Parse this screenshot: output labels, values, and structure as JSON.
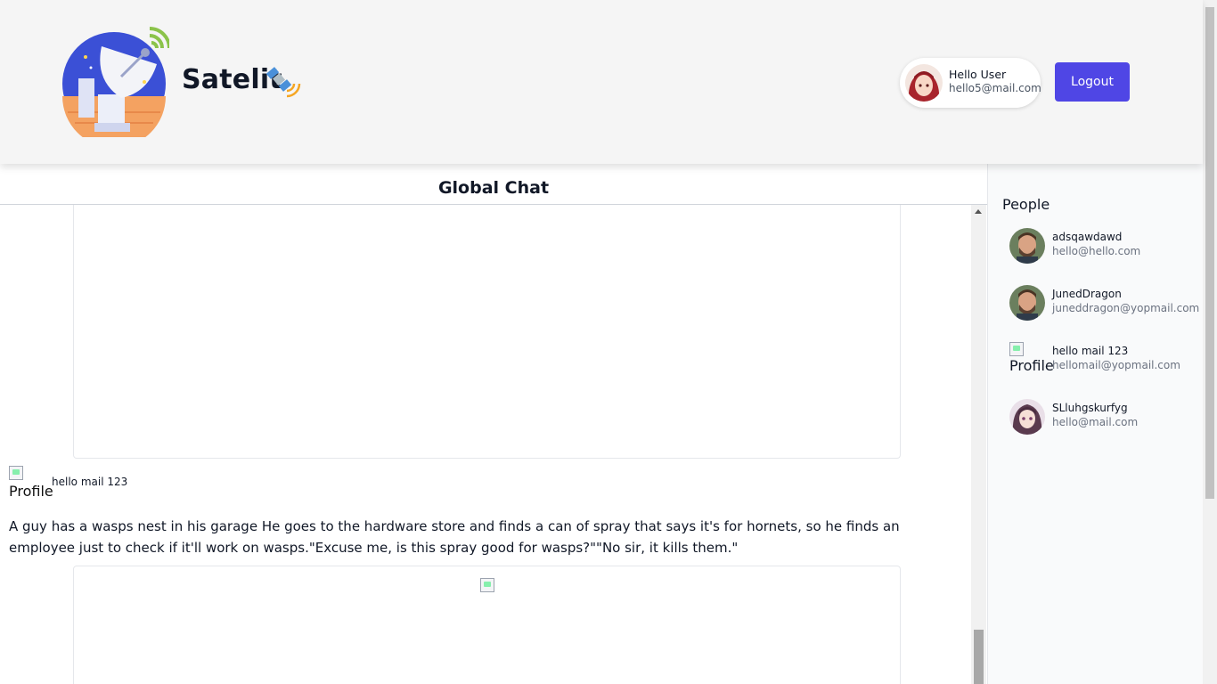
{
  "header": {
    "brand": "Satelit",
    "user": {
      "greeting": "Hello User",
      "email": "hello5@mail.com"
    },
    "logout_label": "Logout"
  },
  "chat": {
    "title": "Global Chat",
    "messages": [
      {
        "avatar_alt": "Profile",
        "author": "hello mail 123",
        "text": "A guy has a wasps nest in his garage He goes to the hardware store and finds a can of spray that says it's for hornets, so he finds an employee just to check if it'll work on wasps.\"Excuse me, is this spray good for wasps?\"\"No sir, it kills them.\""
      }
    ]
  },
  "sidebar": {
    "title": "People",
    "people": [
      {
        "name": "adsqawdawd",
        "email": "hello@hello.com",
        "avatar": "man-photo"
      },
      {
        "name": "JunedDragon",
        "email": "juneddragon@yopmail.com",
        "avatar": "man-photo"
      },
      {
        "name": "hello mail 123",
        "email": "hellomail@yopmail.com",
        "avatar": "broken-image",
        "avatar_alt": "Profile"
      },
      {
        "name": "SLluhgskurfyg",
        "email": "hello@mail.com",
        "avatar": "anime-girl"
      }
    ]
  },
  "colors": {
    "accent": "#4f46e5",
    "header_bg": "#f5f5f5",
    "sidebar_bg": "#f9fafb"
  }
}
